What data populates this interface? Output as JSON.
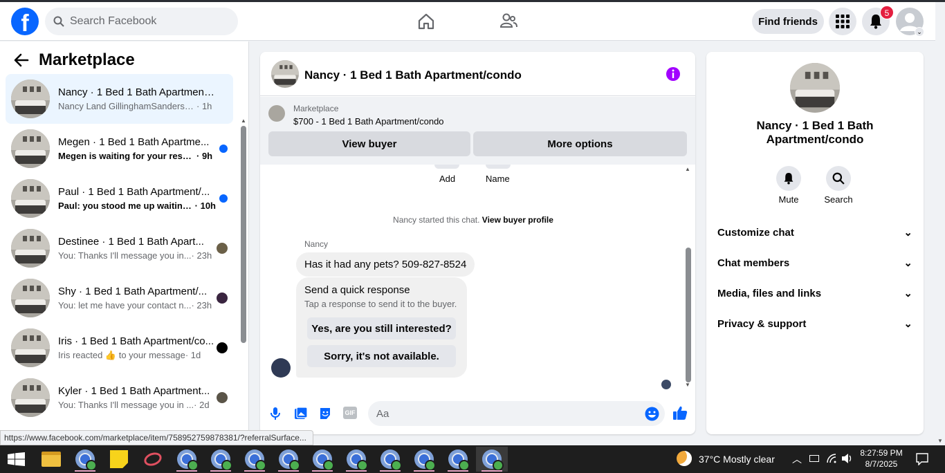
{
  "header": {
    "search_placeholder": "Search Facebook",
    "find_friends_label": "Find friends",
    "notification_count": "5",
    "logo_letter": "f"
  },
  "sidebar": {
    "title": "Marketplace",
    "conversations": [
      {
        "name": "Nancy · 1 Bed 1 Bath Apartment/...",
        "preview": "Nancy Land GillinghamSanders-Cro...",
        "time": "· 1h",
        "unread": false,
        "active": true
      },
      {
        "name": "Megen · 1 Bed 1 Bath Apartme...",
        "preview": "Megen is waiting for your respo...",
        "time": "· 9h",
        "unread": true,
        "active": false
      },
      {
        "name": "Paul · 1 Bed 1 Bath Apartment/...",
        "preview": "Paul: you stood me up waiting ...",
        "time": "· 10h",
        "unread": true,
        "active": false
      },
      {
        "name": "Destinee · 1 Bed 1 Bath Apart...",
        "preview": "You: Thanks I'll message you in...",
        "time": "· 23h",
        "unread": false,
        "active": false
      },
      {
        "name": "Shy · 1 Bed 1 Bath Apartment/...",
        "preview": "You: let me have your contact n...",
        "time": "· 23h",
        "unread": false,
        "active": false
      },
      {
        "name": "Iris · 1 Bed 1 Bath Apartment/co...",
        "preview": "Iris reacted 👍 to your message",
        "time": "· 1d",
        "unread": false,
        "active": false
      },
      {
        "name": "Kyler · 1 Bed 1 Bath Apartment...",
        "preview": "You: Thanks I'll message you in ...",
        "time": "· 2d",
        "unread": false,
        "active": false
      }
    ]
  },
  "chat": {
    "title": "Nancy · 1 Bed 1 Bath Apartment/condo",
    "marketplace_label": "Marketplace",
    "listing": "$700 - 1 Bed 1 Bath Apartment/condo",
    "view_buyer_label": "View buyer",
    "more_options_label": "More options",
    "add_label": "Add",
    "name_label": "Name",
    "started_text": "Nancy started this chat.",
    "view_profile_link": "View buyer profile",
    "sender": "Nancy",
    "message": "Has it had any pets? 509-827-8524",
    "quick_title": "Send a quick response",
    "quick_sub": "Tap a response to send it to the buyer.",
    "quick_replies": [
      "Yes, are you still interested?",
      "Sorry, it's not available."
    ],
    "input_placeholder": "Aa",
    "gif_label": "GIF"
  },
  "info_panel": {
    "title": "Nancy · 1 Bed 1 Bath Apartment/condo",
    "mute_label": "Mute",
    "search_label": "Search",
    "sections": [
      "Customize chat",
      "Chat members",
      "Media, files and links",
      "Privacy & support"
    ]
  },
  "status_url": "https://www.facebook.com/marketplace/item/758952759878381/?referralSurface...",
  "taskbar": {
    "weather_temp": "37°C",
    "weather_desc": "Mostly clear",
    "time": "8:27:59 PM",
    "date": "8/7/2025"
  },
  "colors": {
    "brand": "#0866ff",
    "badge": "#e41e3f",
    "info_icon": "#a200ff"
  }
}
